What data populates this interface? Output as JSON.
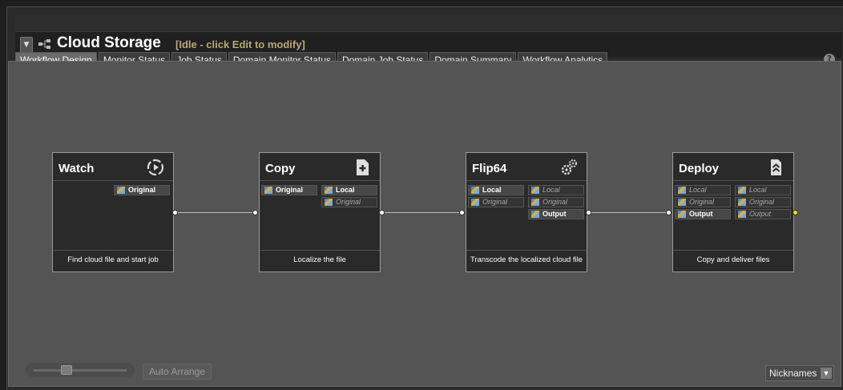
{
  "header": {
    "title": "Cloud Storage",
    "status": "[Idle - click Edit to modify]"
  },
  "tabs": [
    {
      "label": "Workflow Design",
      "active": true
    },
    {
      "label": "Monitor Status"
    },
    {
      "label": "Job Status"
    },
    {
      "label": "Domain Monitor Status"
    },
    {
      "label": "Domain Job Status"
    },
    {
      "label": "Domain Summary"
    },
    {
      "label": "Workflow Analytics"
    }
  ],
  "help_label": "?",
  "nodes": [
    {
      "title": "Watch",
      "icon": "watch-icon",
      "description": "Find cloud file and start job",
      "inputs": [],
      "outputs": [
        {
          "label": "Original",
          "style": "bold"
        }
      ]
    },
    {
      "title": "Copy",
      "icon": "copy-file-icon",
      "description": "Localize the file",
      "inputs": [
        {
          "label": "Original",
          "style": "bold"
        }
      ],
      "outputs": [
        {
          "label": "Local",
          "style": "bold"
        },
        {
          "label": "Original",
          "style": "dim"
        }
      ]
    },
    {
      "title": "Flip64",
      "icon": "gears-icon",
      "description": "Transcode the localized cloud file",
      "inputs": [
        {
          "label": "Local",
          "style": "bold"
        },
        {
          "label": "Original",
          "style": "dim"
        }
      ],
      "outputs": [
        {
          "label": "Local",
          "style": "dim"
        },
        {
          "label": "Original",
          "style": "dim"
        },
        {
          "label": "Output",
          "style": "bold"
        }
      ]
    },
    {
      "title": "Deploy",
      "icon": "deploy-icon",
      "description": "Copy and deliver files",
      "inputs": [
        {
          "label": "Local",
          "style": "dim"
        },
        {
          "label": "Original",
          "style": "dim"
        },
        {
          "label": "Output",
          "style": "bold"
        }
      ],
      "outputs": [
        {
          "label": "Local",
          "style": "dim"
        },
        {
          "label": "Original",
          "style": "dim"
        },
        {
          "label": "Output",
          "style": "dim"
        }
      ]
    }
  ],
  "controls": {
    "auto_arrange_label": "Auto Arrange",
    "nicknames_label": "Nicknames"
  }
}
